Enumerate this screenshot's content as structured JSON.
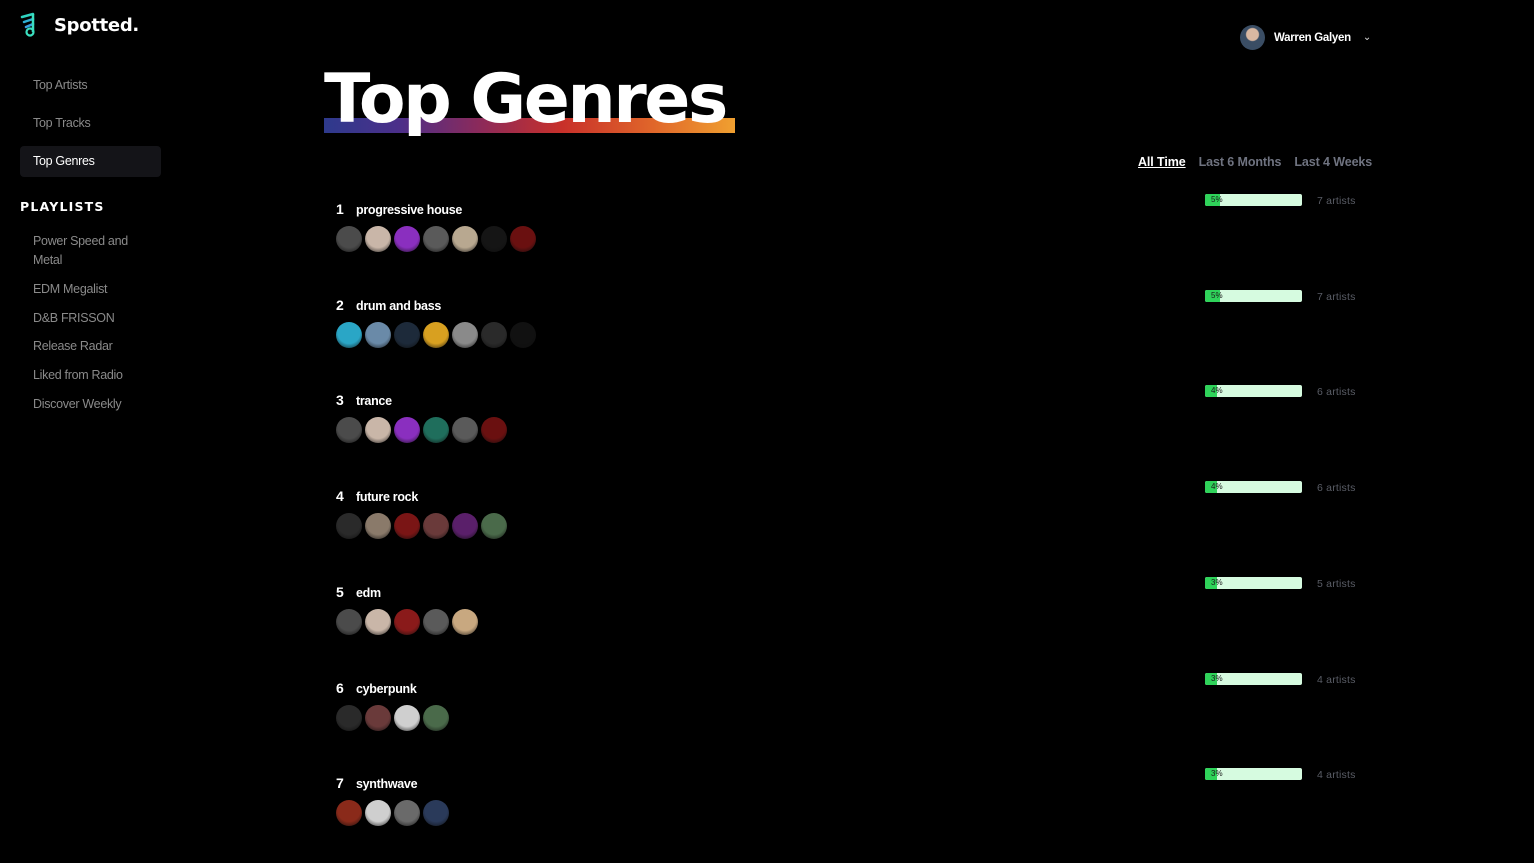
{
  "app": {
    "name": "Spotted."
  },
  "sidebar": {
    "nav": [
      "Top Artists",
      "Top Tracks",
      "Top Genres"
    ],
    "playlists_heading": "PLAYLISTS",
    "playlists": [
      "Power Speed and Metal",
      "EDM Megalist",
      "D&B FRISSON",
      "Release Radar",
      "Liked from Radio",
      "Discover Weekly"
    ]
  },
  "user": {
    "name": "Warren Galyen"
  },
  "page": {
    "title": "Top Genres"
  },
  "tabs": [
    "All Time",
    "Last 6 Months",
    "Last 4 Weeks"
  ],
  "genres": [
    {
      "rank": "1",
      "name": "progressive house",
      "percent": "5%",
      "fraction": 0.05,
      "artists": "7 artists",
      "avatar_colors": [
        "#4b4b4b",
        "#c9b6a8",
        "#8a2fbf",
        "#5a5a5a",
        "#b8a890",
        "#151515",
        "#6a1010"
      ]
    },
    {
      "rank": "2",
      "name": "drum and bass",
      "percent": "5%",
      "fraction": 0.05,
      "artists": "7 artists",
      "avatar_colors": [
        "#2aa6c6",
        "#6a8aa8",
        "#1d2a3a",
        "#d8a020",
        "#8a8a8a",
        "#2a2a2a",
        "#111111"
      ]
    },
    {
      "rank": "3",
      "name": "trance",
      "percent": "4%",
      "fraction": 0.04,
      "artists": "6 artists",
      "avatar_colors": [
        "#4b4b4b",
        "#c9b6a8",
        "#8a2fbf",
        "#1f6e5c",
        "#5a5a5a",
        "#6a1010"
      ]
    },
    {
      "rank": "4",
      "name": "future rock",
      "percent": "4%",
      "fraction": 0.04,
      "artists": "6 artists",
      "avatar_colors": [
        "#2a2a2a",
        "#8a7a6a",
        "#7a1515",
        "#6a3a3a",
        "#5a1f6a",
        "#4a6a4a"
      ]
    },
    {
      "rank": "5",
      "name": "edm",
      "percent": "3%",
      "fraction": 0.03,
      "artists": "5 artists",
      "avatar_colors": [
        "#4b4b4b",
        "#c9b6a8",
        "#8a1a1a",
        "#5a5a5a",
        "#c8a880"
      ]
    },
    {
      "rank": "6",
      "name": "cyberpunk",
      "percent": "3%",
      "fraction": 0.03,
      "artists": "4 artists",
      "avatar_colors": [
        "#2a2a2a",
        "#6a3a3a",
        "#cfcfcf",
        "#4a6a4a"
      ]
    },
    {
      "rank": "7",
      "name": "synthwave",
      "percent": "3%",
      "fraction": 0.03,
      "artists": "4 artists",
      "avatar_colors": [
        "#8a2a1a",
        "#cfcfcf",
        "#6a6a6a",
        "#2a3a5a"
      ]
    }
  ]
}
